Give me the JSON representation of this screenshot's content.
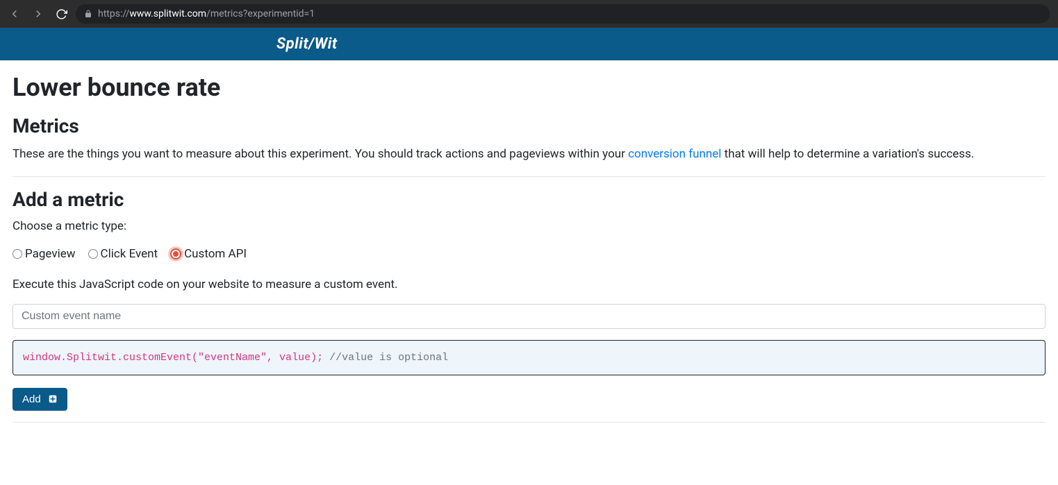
{
  "browser": {
    "url_prefix": "https://",
    "url_domain": "www.splitwit.com",
    "url_path": "/metrics?experimentid=1"
  },
  "header": {
    "logo_text": "Split/Wit"
  },
  "main": {
    "page_title": "Lower bounce rate",
    "metrics_heading": "Metrics",
    "description_before": "These are the things you want to measure about this experiment. You should track actions and pageviews within your ",
    "description_link": "conversion funnel",
    "description_after": " that will help to determine a variation's success.",
    "add_metric_heading": "Add a metric",
    "choose_type_label": "Choose a metric type:",
    "radio_options": {
      "pageview": "Pageview",
      "click_event": "Click Event",
      "custom_api": "Custom API"
    },
    "instruction_text": "Execute this JavaScript code on your website to measure a custom event.",
    "input_placeholder": "Custom event name",
    "code_call": "window.Splitwit.customEvent(\"eventName\", value);",
    "code_comment": " //value is optional",
    "add_button_label": "Add"
  }
}
